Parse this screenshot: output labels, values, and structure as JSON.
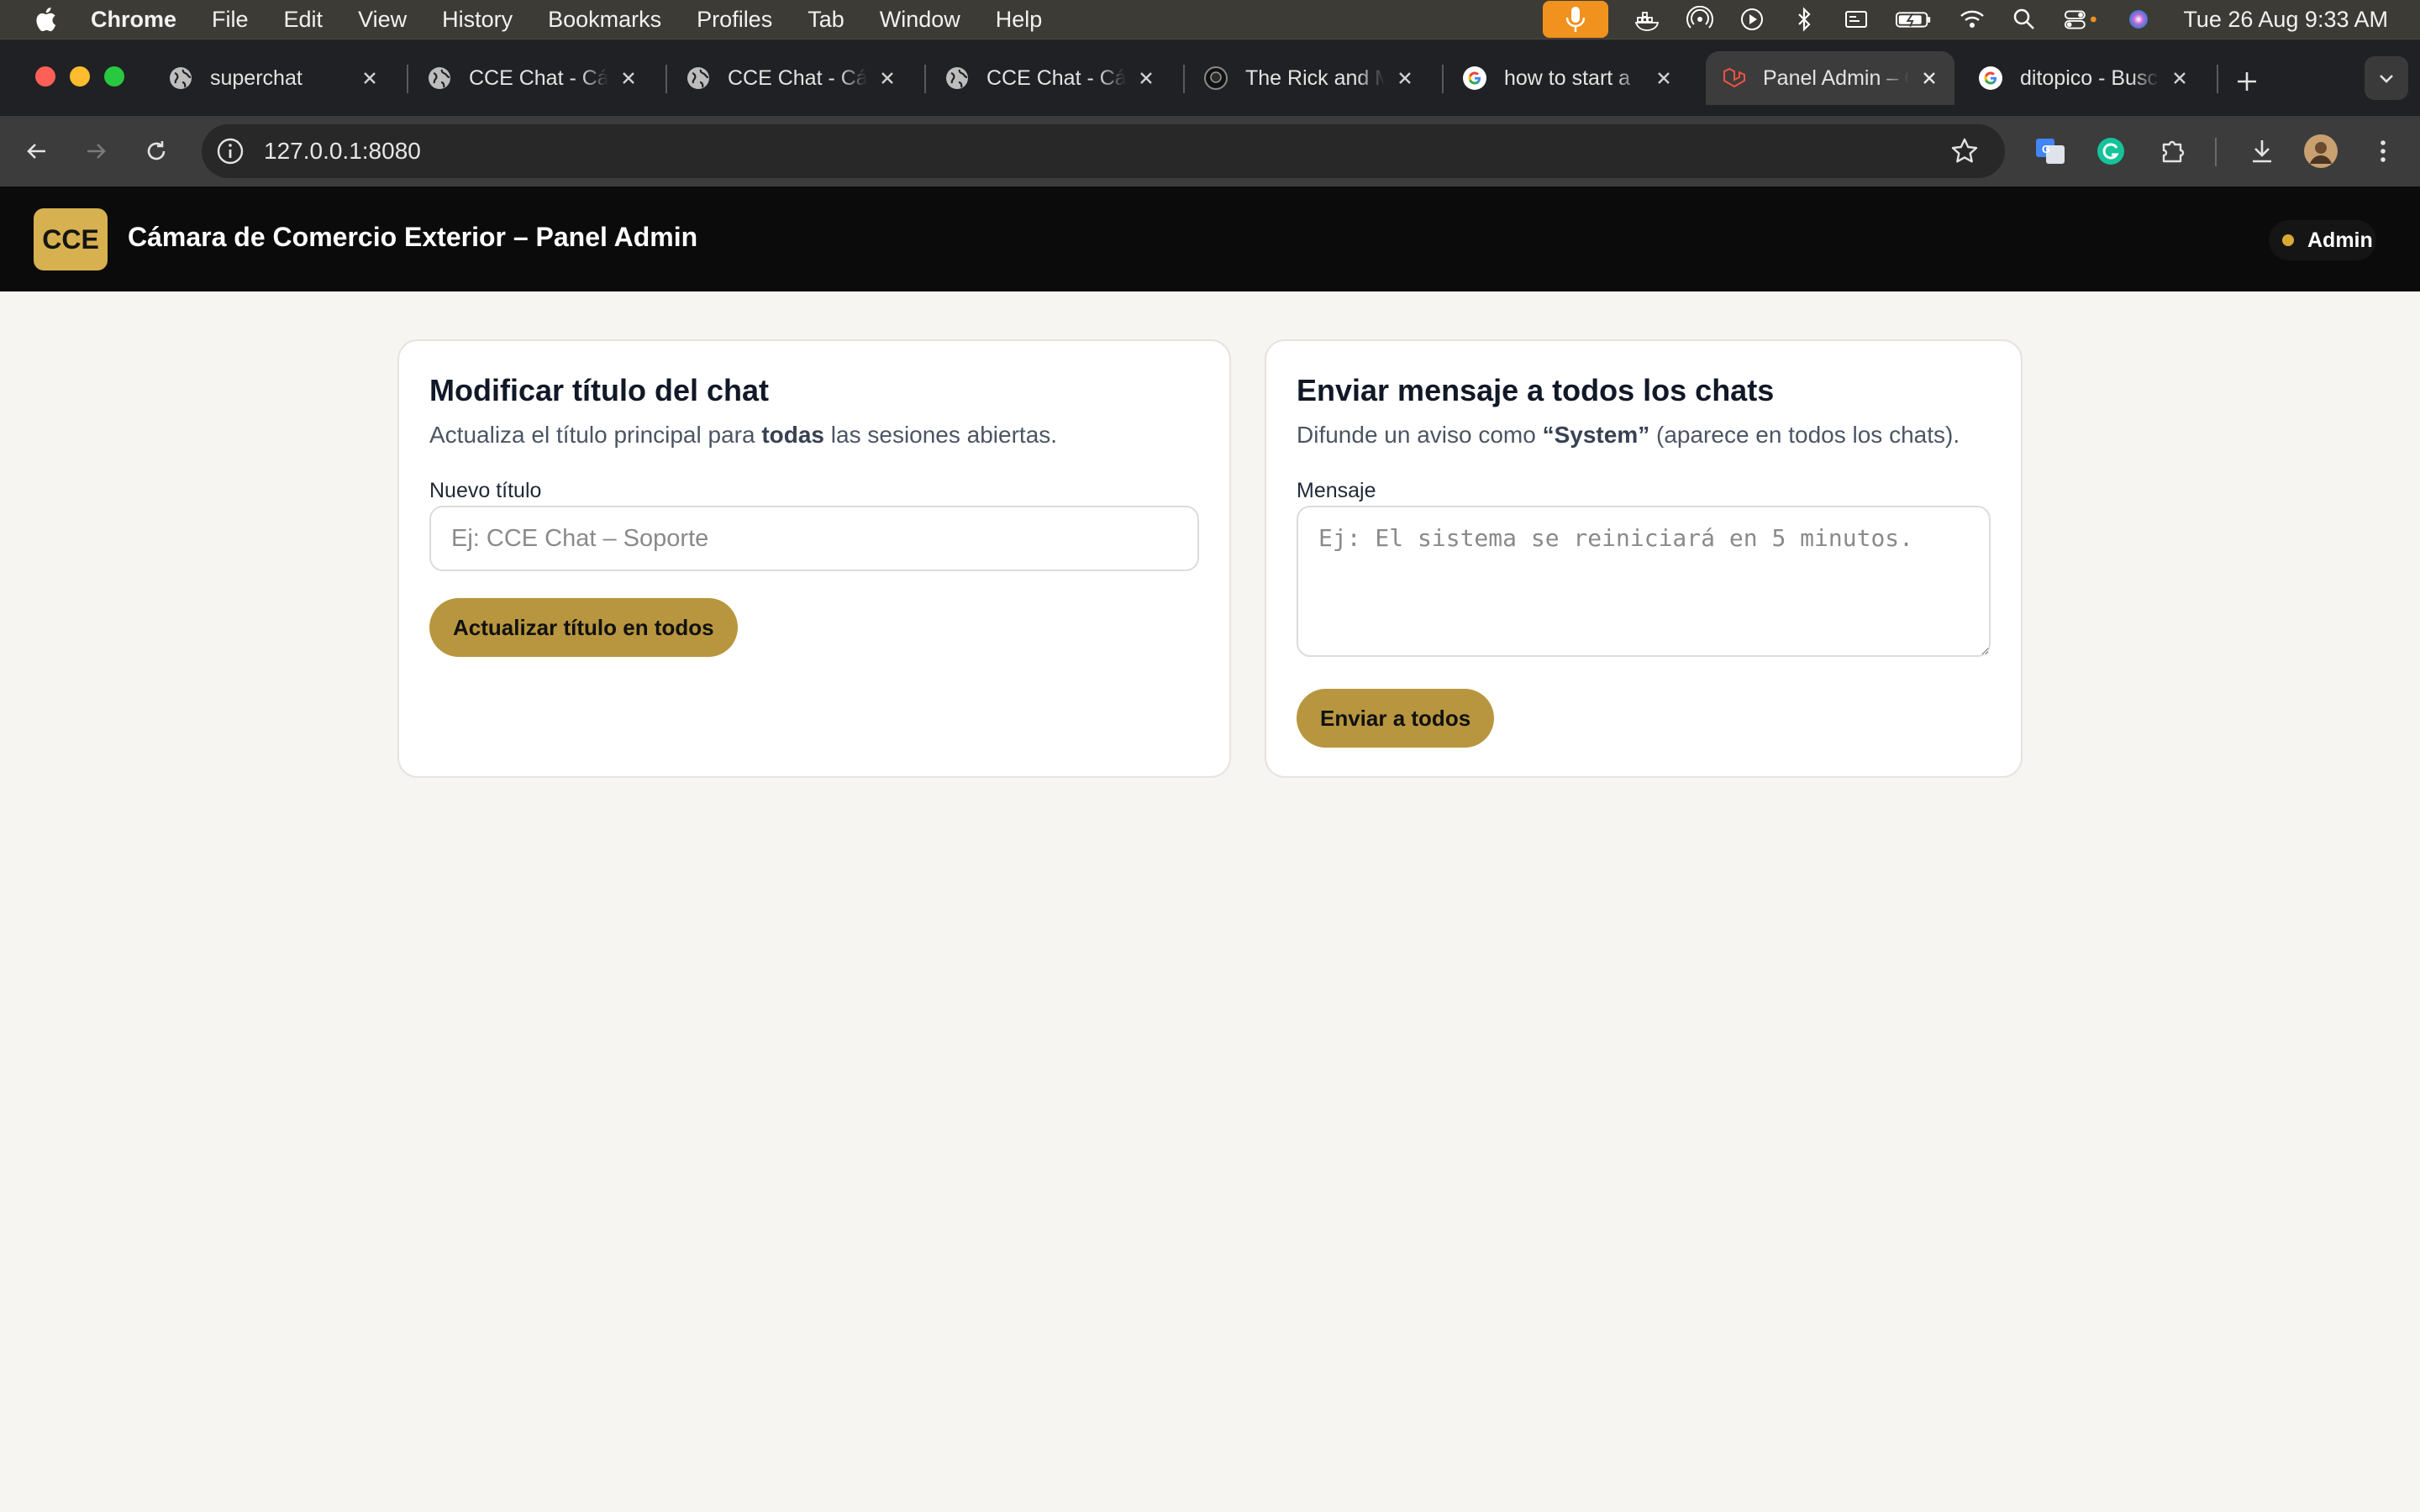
{
  "menubar": {
    "app": "Chrome",
    "items": [
      "File",
      "Edit",
      "View",
      "History",
      "Bookmarks",
      "Profiles",
      "Tab",
      "Window",
      "Help"
    ],
    "clock": "Tue 26 Aug  9:33 AM"
  },
  "tabs": [
    {
      "title": "superchat",
      "icon": "globe-icon"
    },
    {
      "title": "CCE Chat - Cámara",
      "icon": "globe-icon"
    },
    {
      "title": "CCE Chat - Cámara",
      "icon": "globe-icon"
    },
    {
      "title": "CCE Chat - Cámara",
      "icon": "globe-icon"
    },
    {
      "title": "The Rick and Morty",
      "icon": "rick-and-morty-icon"
    },
    {
      "title": "how to start a",
      "icon": "google-icon"
    },
    {
      "title": "Panel Admin – CCE",
      "icon": "laravel-icon",
      "active": true
    },
    {
      "title": "ditopico - Buscar",
      "icon": "google-icon"
    }
  ],
  "address_bar": {
    "url": "127.0.0.1:8080"
  },
  "header": {
    "logo_text": "CCE",
    "title": "Cámara de Comercio Exterior – Panel Admin",
    "user_badge": "Admin",
    "accent_color": "#d7b04f"
  },
  "title_card": {
    "heading": "Modificar título del chat",
    "desc_pre": "Actualiza el título principal para ",
    "desc_bold": "todas",
    "desc_post": " las sesiones abiertas.",
    "field_label": "Nuevo título",
    "placeholder": "Ej: CCE Chat – Soporte",
    "value": "",
    "button": "Actualizar título en todos"
  },
  "broadcast_card": {
    "heading": "Enviar mensaje a todos los chats",
    "desc_pre": "Difunde un aviso como ",
    "desc_bold": "“System”",
    "desc_post": " (aparece en todos los chats).",
    "field_label": "Mensaje",
    "placeholder": "Ej: El sistema se reiniciará en 5 minutos.",
    "value": "",
    "button": "Enviar a todos"
  },
  "colors": {
    "button": "#b8963f",
    "page_bg": "#f6f5f1",
    "header_bg": "#0b0b0b"
  }
}
